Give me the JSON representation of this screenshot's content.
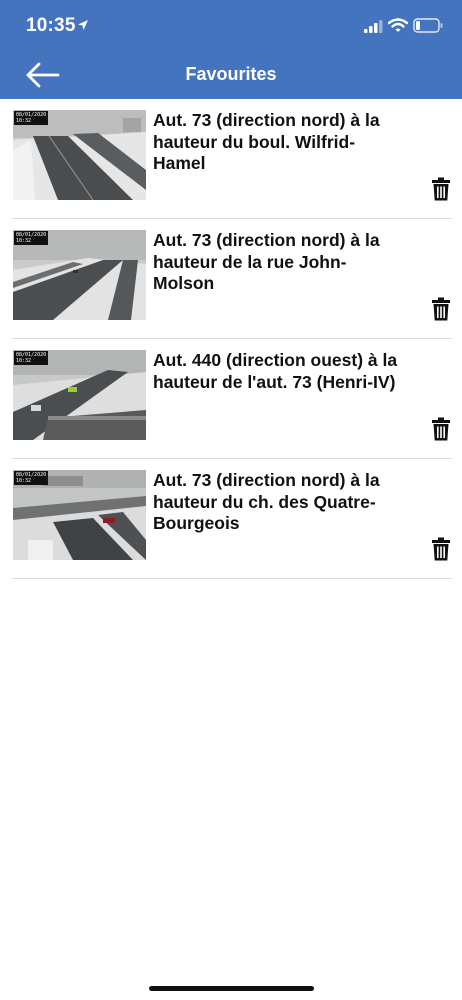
{
  "status_bar": {
    "time": "10:35",
    "icons": [
      "location-arrow-icon",
      "signal-icon",
      "wifi-icon",
      "battery-icon"
    ]
  },
  "header": {
    "title": "Favourites",
    "back_icon": "arrow-left-icon",
    "color": "#4474bd"
  },
  "favourites": [
    {
      "title": "Aut. 73 (direction nord) à la hauteur du boul. Wilfrid-Hamel",
      "stamp_date": "08/01/2020",
      "stamp_time": "10:32"
    },
    {
      "title": "Aut. 73 (direction nord) à la hauteur de la rue John-Molson",
      "stamp_date": "08/01/2020",
      "stamp_time": "10:32"
    },
    {
      "title": "Aut. 440 (direction ouest) à la hauteur de l'aut. 73 (Henri-IV)",
      "stamp_date": "08/01/2020",
      "stamp_time": "10:32"
    },
    {
      "title": "Aut. 73 (direction nord) à la hauteur du ch. des Quatre-Bourgeois",
      "stamp_date": "08/01/2020",
      "stamp_time": "10:32"
    }
  ],
  "delete_icon": "trash-icon"
}
